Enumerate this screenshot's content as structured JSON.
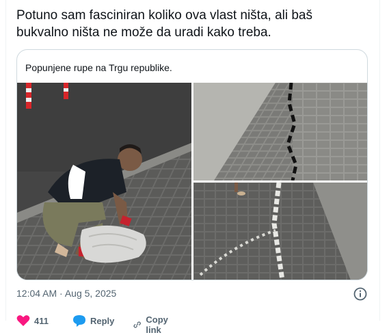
{
  "tweet": {
    "text_line1": "Potuno sam fasciniran koliko ova vlast ništa, ali baš",
    "text_line2": "bukvalno ništa ne može da uradi kako treba."
  },
  "card": {
    "caption": "Popunjene rupe na Trgu republike."
  },
  "meta": {
    "timestamp": "12:04 AM · Aug 5, 2025"
  },
  "actions": {
    "like_count": "411",
    "reply_label": "Reply",
    "copy_label": "Copy link"
  },
  "icons": {
    "like": "heart-icon",
    "reply": "reply-bubble-icon",
    "copy": "link-icon",
    "info": "info-icon"
  },
  "colors": {
    "like_accent": "#f91880",
    "reply_accent": "#1d9bf0",
    "muted_text": "#536471",
    "border": "#cfd9de"
  }
}
